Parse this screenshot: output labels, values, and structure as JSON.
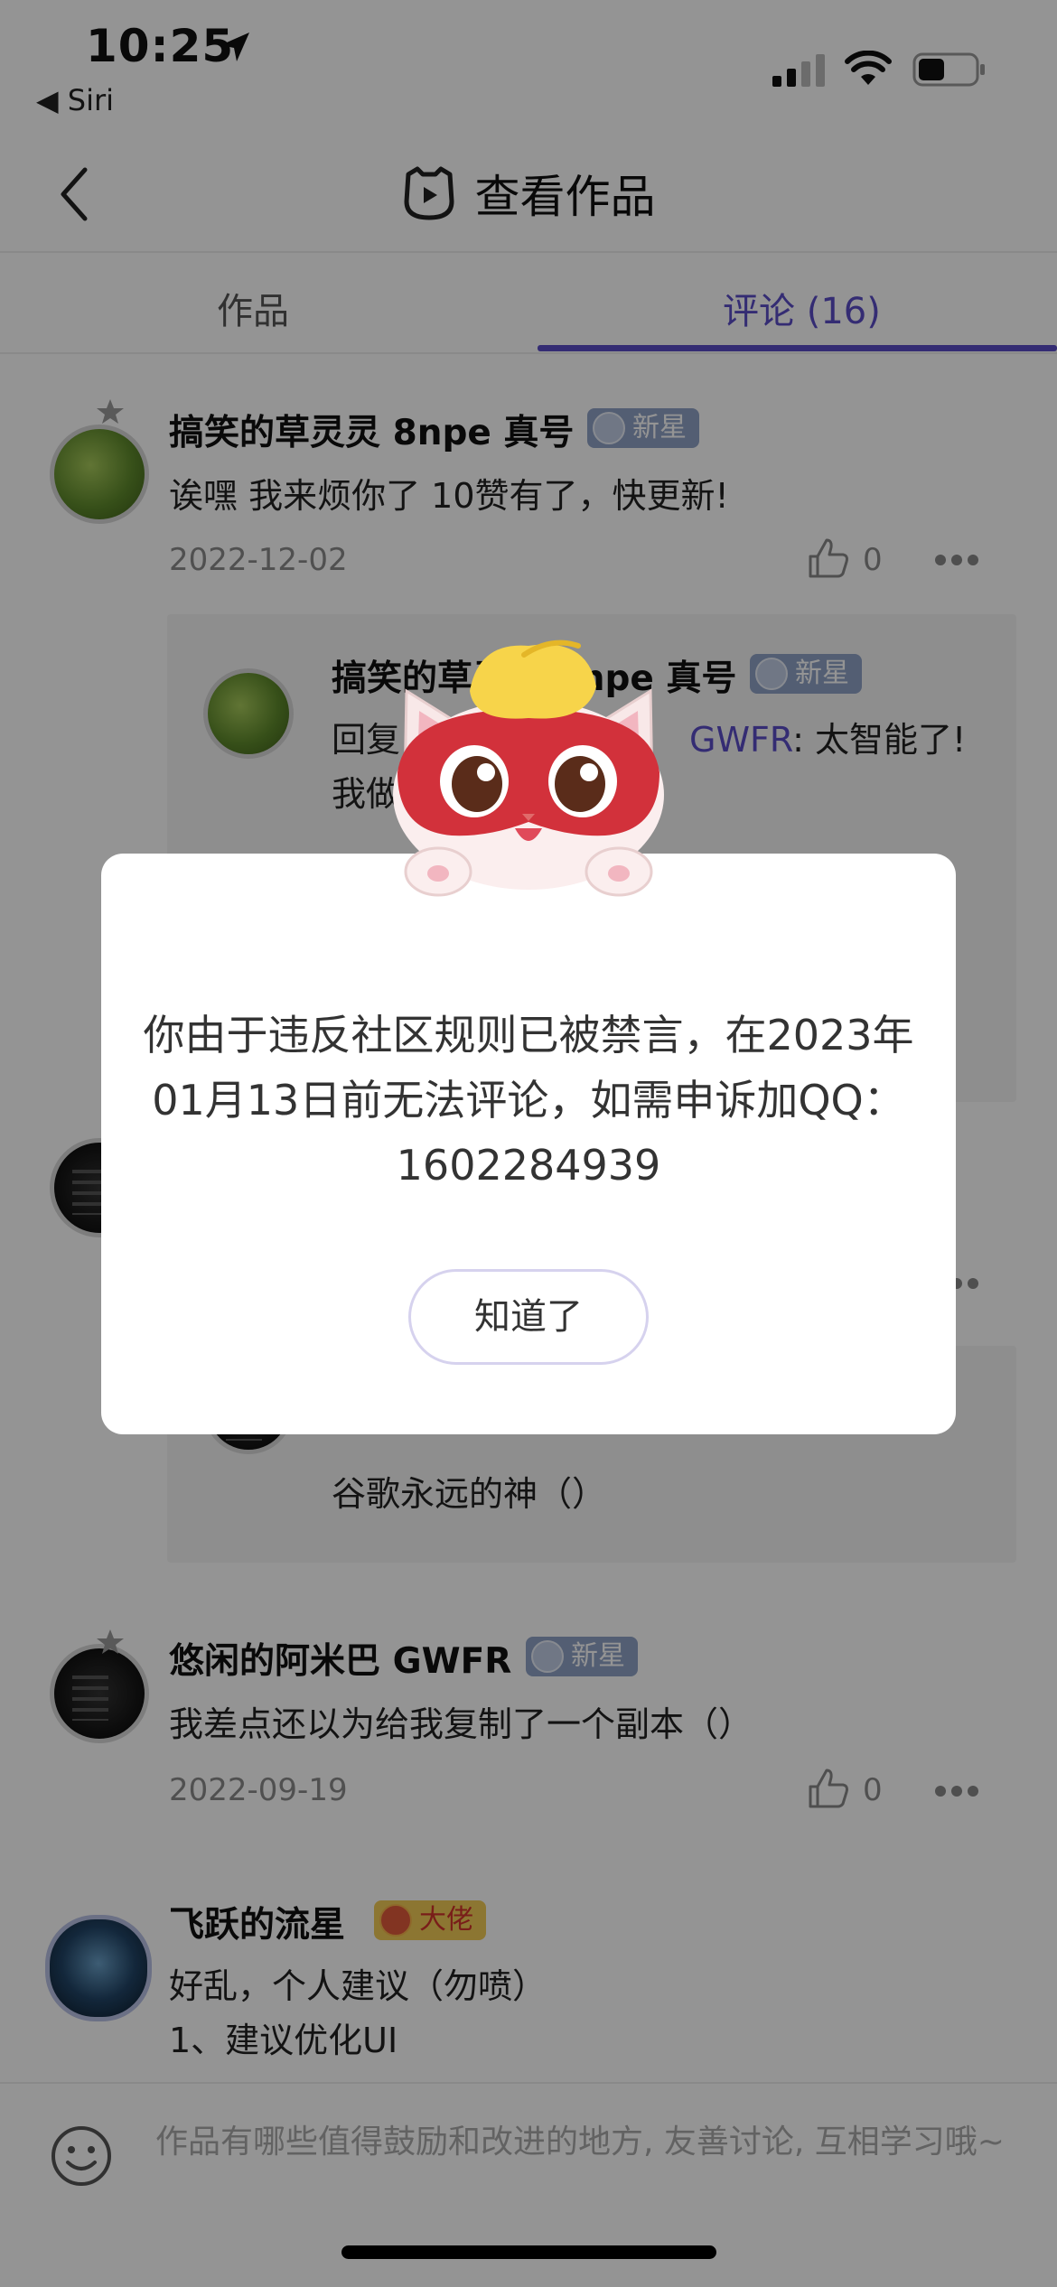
{
  "status_bar": {
    "time": "10:25",
    "back_app": "◀ Siri"
  },
  "nav": {
    "title": "查看作品"
  },
  "tabs": [
    {
      "label": "作品"
    },
    {
      "label": "评论 (16)"
    }
  ],
  "comments": [
    {
      "username": "搞笑的草灵灵 8npe 真号",
      "badge": "新星",
      "text": "诶嘿 我来烦你了 10赞有了，快更新!",
      "date": "2022-12-02",
      "likes": "0",
      "reply": {
        "username": "搞笑的草灵灵 8npe 真号",
        "badge": "新星",
        "prefix": "回复",
        "mention": "GWFR",
        "text": ": 太智能了!",
        "text2": "我做"
      }
    },
    {
      "reply_text": "谷歌永远的神（）"
    },
    {
      "username": "悠闲的阿米巴 GWFR",
      "badge": "新星",
      "text": "我差点还以为给我复制了一个副本（）",
      "date": "2022-09-19",
      "likes": "0"
    },
    {
      "username": "飞跃的流星",
      "badge": "大佬",
      "line1": "好乱，个人建议（勿喷）",
      "line2": "1、建议优化UI"
    }
  ],
  "input": {
    "placeholder": "作品有哪些值得鼓励和改进的地方, 友善讨论, 互相学习哦~"
  },
  "dialog": {
    "message": "你由于违反社区规则已被禁言，在2023年01月13日前无法评论，如需申诉加QQ：1602284939",
    "button": "知道了"
  },
  "colors": {
    "accent": "#5a4cc7",
    "badge_new": "#8fa2c6",
    "badge_gold": "#f2cc57"
  }
}
